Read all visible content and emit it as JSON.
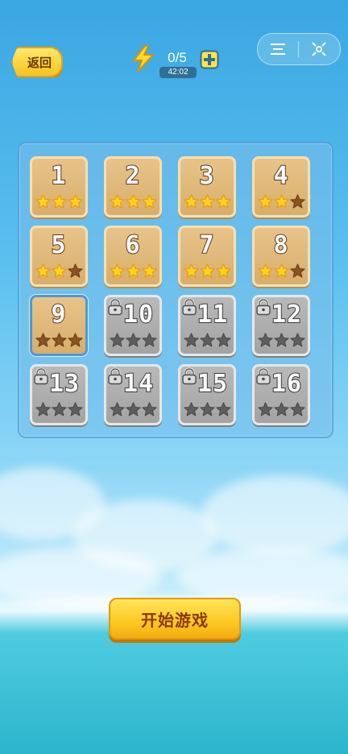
{
  "header": {
    "back_label": "返回",
    "energy_value": "0/5",
    "energy_timer": "42:02"
  },
  "levels": [
    {
      "number": "1",
      "state": "unlocked",
      "stars": 3
    },
    {
      "number": "2",
      "state": "unlocked",
      "stars": 3
    },
    {
      "number": "3",
      "state": "unlocked",
      "stars": 3
    },
    {
      "number": "4",
      "state": "unlocked",
      "stars": 2
    },
    {
      "number": "5",
      "state": "unlocked",
      "stars": 2
    },
    {
      "number": "6",
      "state": "unlocked",
      "stars": 3
    },
    {
      "number": "7",
      "state": "unlocked",
      "stars": 3
    },
    {
      "number": "8",
      "state": "unlocked",
      "stars": 2
    },
    {
      "number": "9",
      "state": "current",
      "stars": 0
    },
    {
      "number": "10",
      "state": "locked",
      "stars": 0
    },
    {
      "number": "11",
      "state": "locked",
      "stars": 0
    },
    {
      "number": "12",
      "state": "locked",
      "stars": 0
    },
    {
      "number": "13",
      "state": "locked",
      "stars": 0
    },
    {
      "number": "14",
      "state": "locked",
      "stars": 0
    },
    {
      "number": "15",
      "state": "locked",
      "stars": 0
    },
    {
      "number": "16",
      "state": "locked",
      "stars": 0
    }
  ],
  "start_button_label": "开始游戏",
  "colors": {
    "star_gold": "#ffd21f",
    "star_empty_unlocked": "#8a5320",
    "star_empty_locked": "#5e5e5e"
  },
  "icons": {
    "back": "back-arrow-icon",
    "energy": "lightning-bolt-icon",
    "add": "plus-icon",
    "menu": "hamburger-menu-icon",
    "close": "close-icon",
    "lock": "padlock-icon",
    "star": "star-icon"
  }
}
